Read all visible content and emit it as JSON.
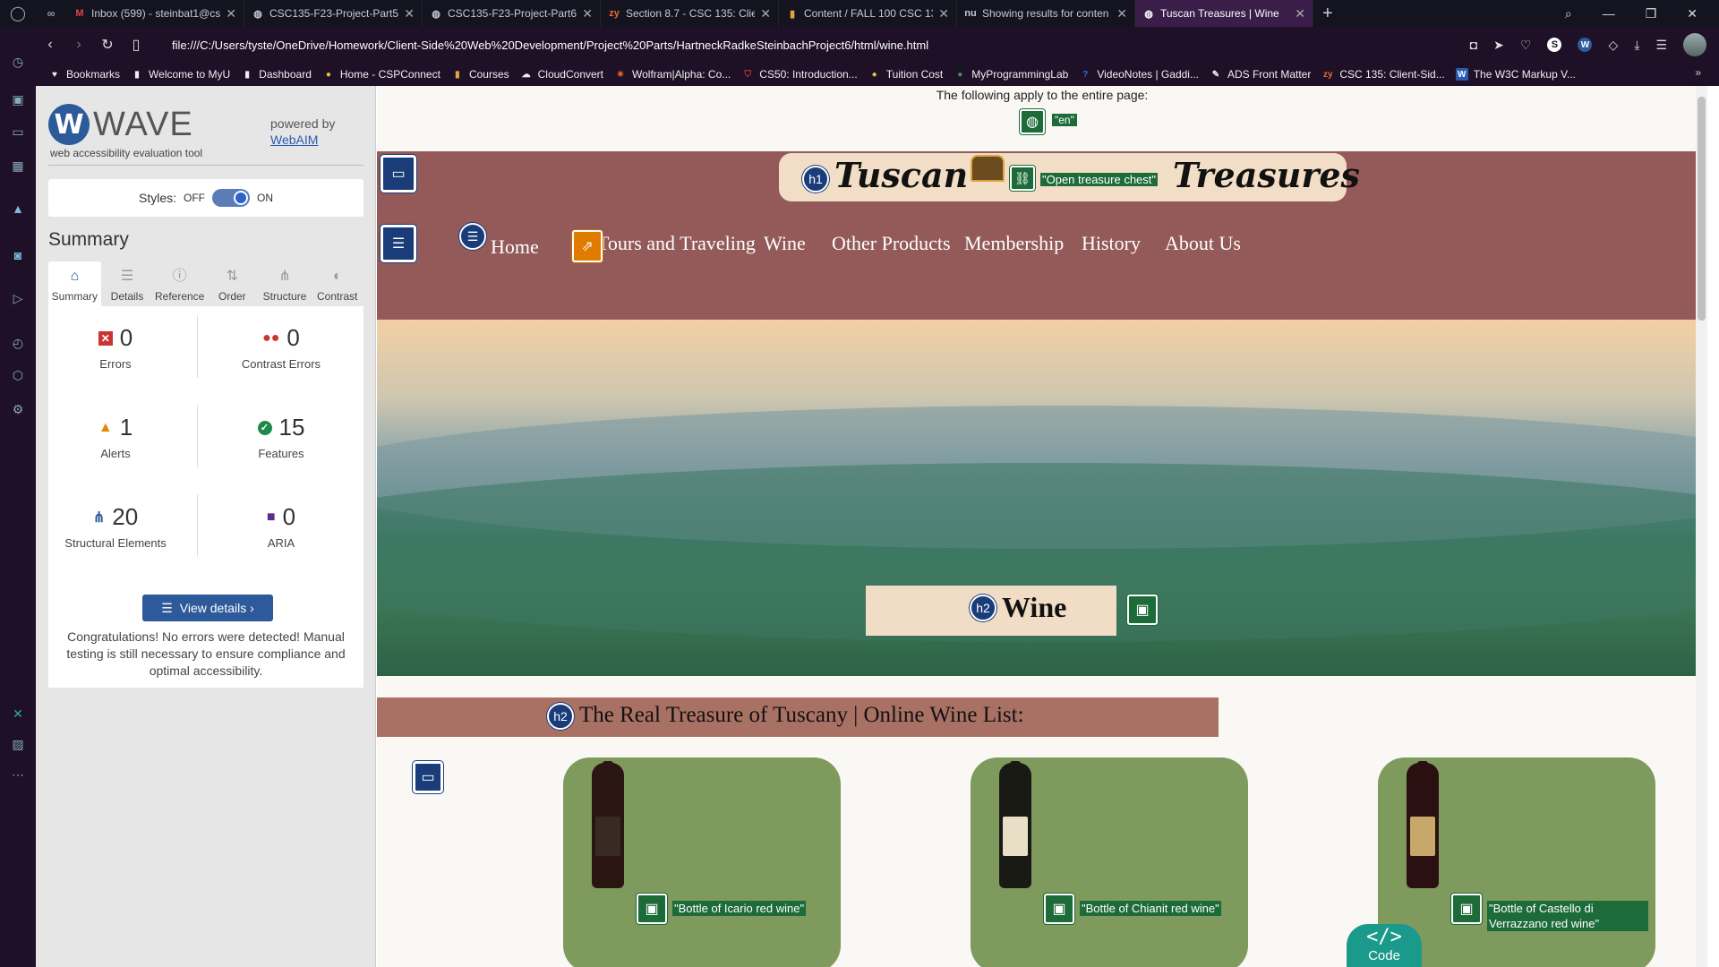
{
  "tabs": [
    {
      "label": "Inbox (599) - steinbat1@cs",
      "icon": "gmail-icon",
      "color": "#d44"
    },
    {
      "label": "CSC135-F23-Project-Part5",
      "icon": "globe-icon",
      "color": "#ccc"
    },
    {
      "label": "CSC135-F23-Project-Part6",
      "icon": "globe-icon",
      "color": "#ccc"
    },
    {
      "label": "Section 8.7 - CSC 135: Clier",
      "icon": "zy-icon",
      "color": "#e86a2a"
    },
    {
      "label": "Content / FALL 100 CSC 13",
      "icon": "chart-icon",
      "color": "#e8a33a"
    },
    {
      "label": "Showing results for conten",
      "icon": "nu-icon",
      "color": "#ccc"
    },
    {
      "label": "Tuscan Treasures | Wine",
      "icon": "globe-icon",
      "color": "#fff",
      "active": true
    }
  ],
  "address": {
    "url": "file:///C:/Users/tyste/OneDrive/Homework/Client-Side%20Web%20Development/Project%20Parts/HartneckRadkeSteinbachProject6/html/wine.html"
  },
  "bookmarks": [
    {
      "label": "Bookmarks",
      "icon": "heart-icon",
      "color": "#eee"
    },
    {
      "label": "Welcome to MyU",
      "icon": "page-icon",
      "color": "#eee"
    },
    {
      "label": "Dashboard",
      "icon": "page-icon",
      "color": "#eee"
    },
    {
      "label": "Home - CSPConnect",
      "icon": "csp-icon",
      "color": "#e8c33a"
    },
    {
      "label": "Courses",
      "icon": "chart-icon",
      "color": "#e8a33a"
    },
    {
      "label": "CloudConvert",
      "icon": "cloud-icon",
      "color": "#ddd"
    },
    {
      "label": "Wolfram|Alpha: Co...",
      "icon": "wolfram-icon",
      "color": "#e85a2a"
    },
    {
      "label": "CS50: Introduction...",
      "icon": "harvard-icon",
      "color": "#a33"
    },
    {
      "label": "Tuition Cost",
      "icon": "csp-icon",
      "color": "#e8c33a"
    },
    {
      "label": "MyProgrammingLab",
      "icon": "mpl-icon",
      "color": "#3a9a3a"
    },
    {
      "label": "VideoNotes | Gaddi...",
      "icon": "help-icon",
      "color": "#2a6ae8"
    },
    {
      "label": "ADS Front Matter",
      "icon": "ads-icon",
      "color": "#ddd"
    },
    {
      "label": "CSC 135: Client-Sid...",
      "icon": "zy-icon",
      "color": "#e86a2a"
    },
    {
      "label": "The W3C Markup V...",
      "icon": "w3c-icon",
      "color": "#2a5ab0"
    }
  ],
  "wave": {
    "logo_letter": "W",
    "logo_name": "WAVE",
    "tagline": "web accessibility evaluation tool",
    "powered_by": "powered by",
    "webaim": "WebAIM",
    "styles_label": "Styles:",
    "styles_off": "OFF",
    "styles_on": "ON",
    "summary_heading": "Summary",
    "tabs": [
      "Summary",
      "Details",
      "Reference",
      "Order",
      "Structure",
      "Contrast"
    ],
    "stats": {
      "errors": {
        "value": "0",
        "label": "Errors"
      },
      "contrast": {
        "value": "0",
        "label": "Contrast Errors"
      },
      "alerts": {
        "value": "1",
        "label": "Alerts"
      },
      "features": {
        "value": "15",
        "label": "Features"
      },
      "structural": {
        "value": "20",
        "label": "Structural Elements"
      },
      "aria": {
        "value": "0",
        "label": "ARIA"
      }
    },
    "view_details": "View details ›",
    "congrats": "Congratulations! No errors were detected! Manual testing is still necessary to ensure compliance and optimal accessibility."
  },
  "site": {
    "lang_note": "The following apply to the entire page:",
    "lang_tag": "\"en\"",
    "logo_left": "Tuscan",
    "logo_right": "Treasures",
    "chest_alt": "\"Open treasure chest\"",
    "nav": [
      "Home",
      "Tours and Traveling",
      "Wine",
      "Other Products",
      "Membership",
      "History",
      "About Us"
    ],
    "hero_title": "Wine",
    "list_title": "The Real Treasure of Tuscany | Online Wine List:",
    "h1": "h1",
    "h2": "h2",
    "wines": [
      {
        "alt": "\"Bottle of Icario red wine\""
      },
      {
        "alt": "\"Bottle of Chianit red wine\""
      },
      {
        "alt": "\"Bottle of Castello di Verrazzano red wine\""
      }
    ],
    "code_label": "Code"
  }
}
